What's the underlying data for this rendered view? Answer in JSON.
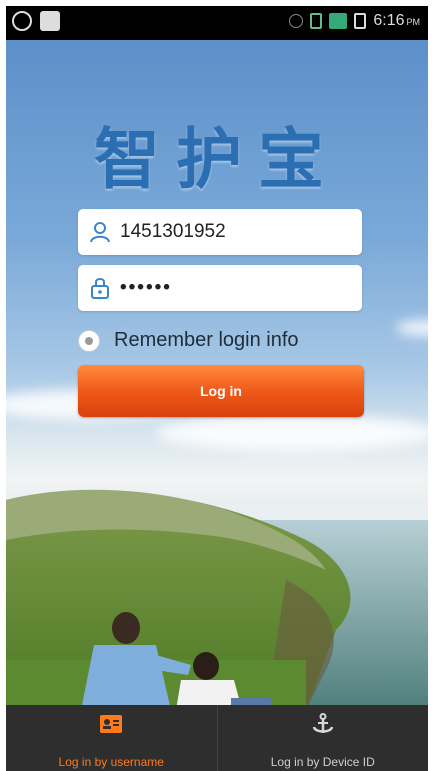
{
  "status_bar": {
    "time": "6:16",
    "time_suffix": "PM"
  },
  "app": {
    "title": "智护宝"
  },
  "login_form": {
    "username_value": "1451301952",
    "password_value": "••••••",
    "remember_label": "Remember login info",
    "login_button_label": "Log in"
  },
  "tab_bar": {
    "tabs": [
      {
        "label": "Log in by username",
        "icon": "id-card-icon",
        "active": true
      },
      {
        "label": "Log in by Device ID",
        "icon": "anchor-icon",
        "active": false
      }
    ]
  },
  "colors": {
    "title_blue": "#2b6fb2",
    "login_orange": "#f05a1a",
    "active_tab": "#ff7b1a"
  }
}
